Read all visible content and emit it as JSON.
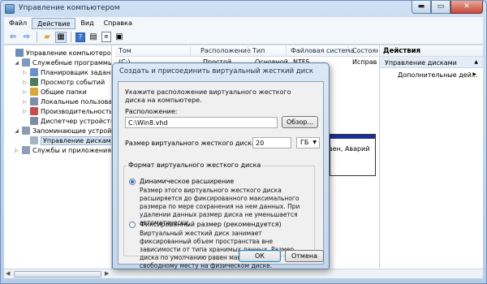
{
  "window": {
    "title": "Управление компьютером",
    "controls": {
      "minimize": "▬",
      "maximize": "▭",
      "close": "✕"
    }
  },
  "menu": [
    "Файл",
    "Действие",
    "Вид",
    "Справка"
  ],
  "tree": {
    "items": [
      {
        "label": "Управление компьютером (л",
        "indent": 0,
        "expander": "",
        "icon_color": "#6d8fb8"
      },
      {
        "label": "Служебные программы",
        "indent": 1,
        "expander": "◢",
        "icon_color": "#7d9ac0"
      },
      {
        "label": "Планировщик заданий",
        "indent": 2,
        "expander": "▷",
        "icon_color": "#6d91c7"
      },
      {
        "label": "Просмотр событий",
        "indent": 2,
        "expander": "▷",
        "icon_color": "#4c7c5a"
      },
      {
        "label": "Общие папки",
        "indent": 2,
        "expander": "▷",
        "icon_color": "#d8a93a"
      },
      {
        "label": "Локальные пользовате",
        "indent": 2,
        "expander": "▷",
        "icon_color": "#7b8fa8"
      },
      {
        "label": "Производительность",
        "indent": 2,
        "expander": "▷",
        "icon_color": "#c0504d"
      },
      {
        "label": "Диспетчер устройств",
        "indent": 2,
        "expander": "",
        "icon_color": "#7d8ea3"
      },
      {
        "label": "Запоминающие устройст",
        "indent": 1,
        "expander": "◢",
        "icon_color": "#8c9db3"
      },
      {
        "label": "Управление дисками",
        "indent": 2,
        "expander": "",
        "icon_color": "#a6b3c4",
        "selected": true
      },
      {
        "label": "Службы и приложения",
        "indent": 1,
        "expander": "▷",
        "icon_color": "#8d9eb5"
      }
    ]
  },
  "list": {
    "columns": [
      "Том",
      "Расположение",
      "Тип",
      "Файловая система",
      "Состояние"
    ],
    "row": [
      "(C:)",
      "Простой",
      "Основной",
      "NTFS",
      "Исправ"
    ]
  },
  "disk_pane": {
    "status_fragment": "вен, Аварий"
  },
  "actions": {
    "header": "Действия",
    "section": "Управление дисками",
    "item": "Дополнительные дей...",
    "section_arrow": "▲",
    "item_arrow": "▶"
  },
  "dialog": {
    "title": "Создать и присоединить виртуальный жесткий диск",
    "instruction": "Укажите расположение виртуального жесткого диска на компьютере.",
    "location_label": "Расположение:",
    "location_value": "C:\\Win8.vhd",
    "browse_button": "Обзор...",
    "size_label": "Размер виртуального жесткого диска:",
    "size_value": "20",
    "size_unit": "ГБ",
    "format_group_title": "Формат виртуального жесткого диска",
    "dynamic_option": {
      "label": "Динамическое расширение",
      "description": "Размер этого виртуального жесткого диска расширяется до фиксированного максимального размера по мере сохранения на нем данных. При удалении данных размер диска не уменьшается автоматически.",
      "selected": true
    },
    "fixed_option": {
      "label": "Фиксированный размер (рекомендуется)",
      "description": "Виртуальный жесткий диск занимает фиксированный объем пространства вне зависимости от типа хранимых данных. Размер диска по умолчанию равен максимальному свободному месту на физическом диске.",
      "selected": false
    },
    "ok_button": "ОК",
    "cancel_button": "Отмена"
  }
}
